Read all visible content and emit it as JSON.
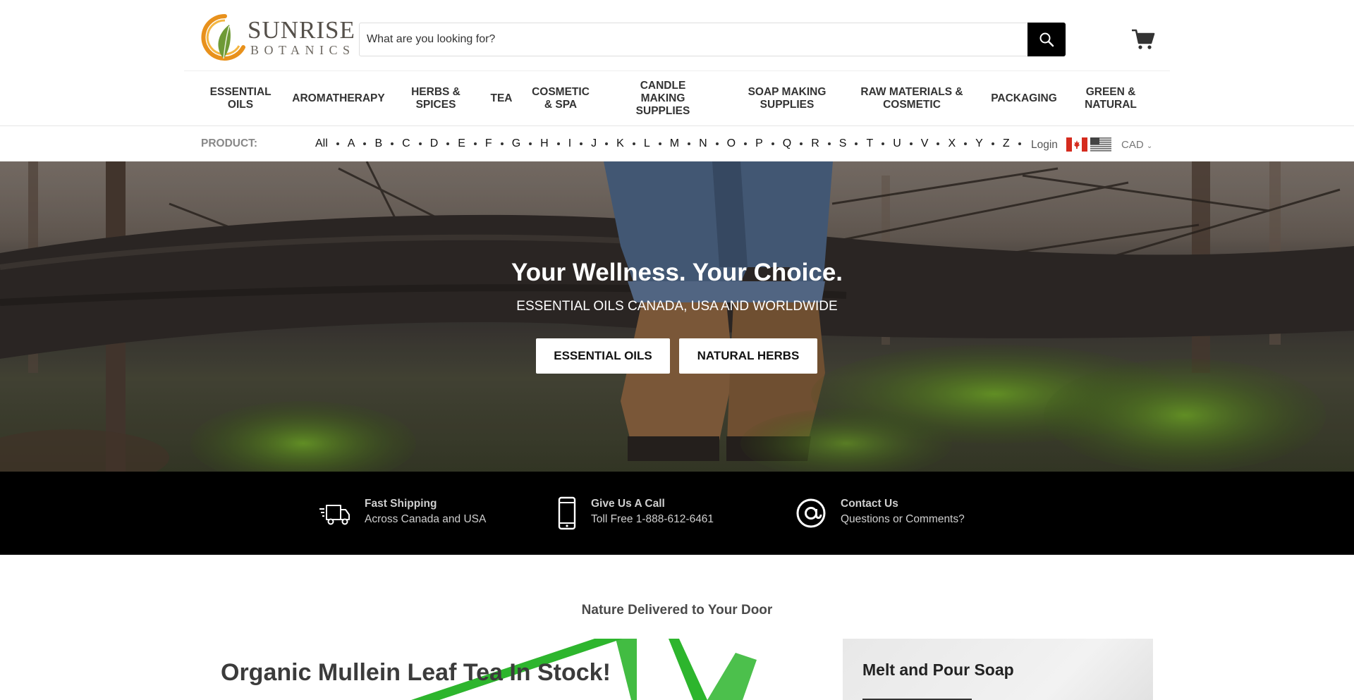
{
  "header": {
    "logo_word": "SUNRISE",
    "logo_sub": "BOTANICS",
    "search_placeholder": "What are you looking for?",
    "search_icon": "search-icon",
    "cart_icon": "cart-icon"
  },
  "nav": {
    "items": [
      {
        "label": "ESSENTIAL OILS"
      },
      {
        "label": "AROMATHERAPY"
      },
      {
        "label": "HERBS & SPICES"
      },
      {
        "label": "TEA"
      },
      {
        "label": "COSMETIC & SPA"
      },
      {
        "label": "CANDLE MAKING SUPPLIES"
      },
      {
        "label": "SOAP MAKING SUPPLIES"
      },
      {
        "label": "RAW MATERIALS & COSMETIC"
      },
      {
        "label": "PACKAGING"
      },
      {
        "label": "GREEN & NATURAL"
      }
    ]
  },
  "alpha_bar": {
    "label": "PRODUCT:",
    "letters": [
      "All",
      "A",
      "B",
      "C",
      "D",
      "E",
      "F",
      "G",
      "H",
      "I",
      "J",
      "K",
      "L",
      "M",
      "N",
      "O",
      "P",
      "Q",
      "R",
      "S",
      "T",
      "U",
      "V",
      "X",
      "Y",
      "Z"
    ],
    "login": "Login",
    "currency": "CAD"
  },
  "hero": {
    "title": "Your Wellness. Your Choice.",
    "subtitle": "ESSENTIAL OILS CANADA, USA AND WORLDWIDE",
    "button_1": "ESSENTIAL OILS",
    "button_2": "NATURAL HERBS"
  },
  "features": [
    {
      "icon": "delivery-truck-icon",
      "title": "Fast Shipping",
      "subtitle": "Across Canada and USA"
    },
    {
      "icon": "phone-icon",
      "title": "Give Us A Call",
      "subtitle": "Toll Free 1-888-612-6461"
    },
    {
      "icon": "at-sign-icon",
      "title": "Contact Us",
      "subtitle": "Questions or Comments?"
    }
  ],
  "promo": {
    "tagline": "Nature Delivered to Your Door",
    "left_heading": "Organic Mullein Leaf Tea In Stock!",
    "right_heading": "Melt and Pour Soap"
  },
  "colors": {
    "accent_orange": "#e8911c",
    "accent_green": "#5b8a2e",
    "stamp_green": "#2db52d",
    "features_bg": "#000000"
  }
}
